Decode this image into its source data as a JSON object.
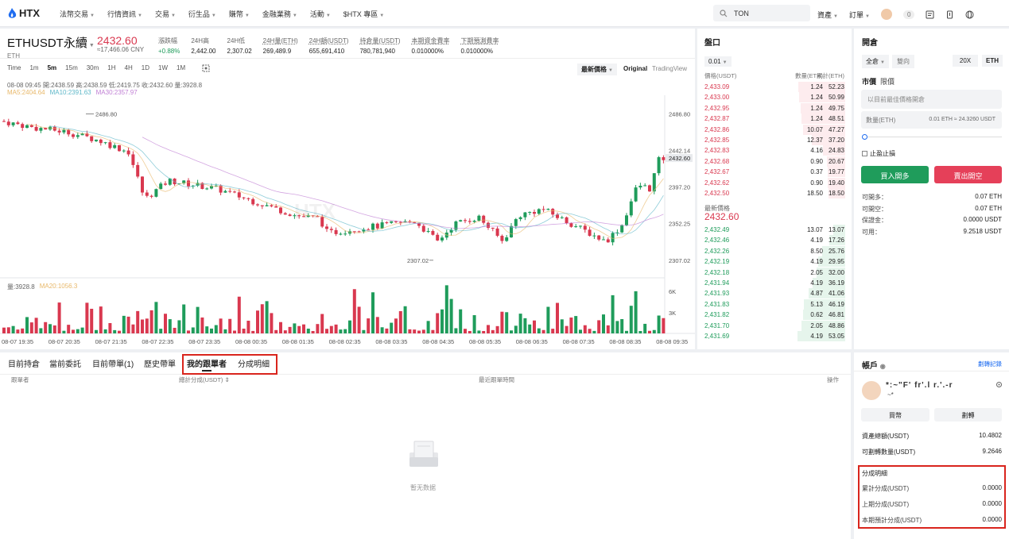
{
  "topbar": {
    "logo": "HTX",
    "nav": [
      "法幣交易",
      "行情資訊",
      "交易",
      "衍生品",
      "賺幣",
      "金融業務",
      "活動",
      "$HTX 專區"
    ],
    "search": "TON",
    "right": [
      "資產",
      "訂單"
    ],
    "badge": "0"
  },
  "ticker": {
    "symbol": "ETHUSDT永續",
    "base": "ETH",
    "price": "2432.60",
    "cny": "≈17,466.06 CNY",
    "stats": [
      {
        "l": "漲跌幅",
        "v": "+0.88%"
      },
      {
        "l": "24H高",
        "v": "2,442.00"
      },
      {
        "l": "24H低",
        "v": "2,307.02"
      },
      {
        "l": "24H量(ETH)",
        "v": "269,489.9"
      },
      {
        "l": "24H額(USDT)",
        "v": "655,691,410"
      },
      {
        "l": "持倉量(USDT)",
        "v": "780,781,940"
      },
      {
        "l": "本期資金費率",
        "v": "0.010000%"
      },
      {
        "l": "下期預測費率",
        "v": "0.010000%"
      }
    ]
  },
  "timeframes": [
    "Time",
    "1m",
    "5m",
    "15m",
    "30m",
    "1H",
    "4H",
    "1D",
    "1W",
    "1M"
  ],
  "chart_opts": {
    "latest": "最新價格",
    "original": "Original",
    "tv": "TradingView"
  },
  "ohlc_line": "08-08 09:45  開:2438.59 高:2438.59 低:2419.75 收:2432.60 量:3928.8",
  "ma_line": {
    "ma5": "MA5:2404.64",
    "ma10": "MA10:2391.63",
    "ma30": "MA30:2357.97"
  },
  "vol_line": {
    "vol": "量:3928.8",
    "ma": "MA20:1056.3"
  },
  "chart_data": {
    "type": "candlestick",
    "yticks": [
      "2486.80",
      "2442.14",
      "2432.60",
      "2397.20",
      "2352.25",
      "2307.02"
    ],
    "xticks": [
      "08-07 19:35",
      "08-07 20:35",
      "08-07 21:35",
      "08-07 22:35",
      "08-07 23:35",
      "08-08 00:35",
      "08-08 01:35",
      "08-08 02:35",
      "08-08 03:35",
      "08-08 04:35",
      "08-08 05:35",
      "08-08 06:35",
      "08-08 07:35",
      "08-08 08:35",
      "08-08 09:35"
    ],
    "high_label": "2486.80",
    "low_label": "2307.02",
    "vol_ticks": [
      "6K",
      "3K"
    ]
  },
  "book": {
    "title": "盤口",
    "step": "0.01",
    "headers": [
      "價格(USDT)",
      "數量(ETH)",
      "累計(ETH)"
    ],
    "asks": [
      [
        "2,433.09",
        "1.24",
        "52.23"
      ],
      [
        "2,433.00",
        "1.24",
        "50.99"
      ],
      [
        "2,432.95",
        "1.24",
        "49.75"
      ],
      [
        "2,432.87",
        "1.24",
        "48.51"
      ],
      [
        "2,432.86",
        "10.07",
        "47.27"
      ],
      [
        "2,432.85",
        "12.37",
        "37.20"
      ],
      [
        "2,432.83",
        "4.16",
        "24.83"
      ],
      [
        "2,432.68",
        "0.90",
        "20.67"
      ],
      [
        "2,432.67",
        "0.37",
        "19.77"
      ],
      [
        "2,432.62",
        "0.90",
        "19.40"
      ],
      [
        "2,432.50",
        "18.50",
        "18.50"
      ]
    ],
    "latest_label": "最新價格",
    "latest": "2432.60",
    "bids": [
      [
        "2,432.49",
        "13.07",
        "13.07"
      ],
      [
        "2,432.46",
        "4.19",
        "17.26"
      ],
      [
        "2,432.26",
        "8.50",
        "25.76"
      ],
      [
        "2,432.19",
        "4.19",
        "29.95"
      ],
      [
        "2,432.18",
        "2.05",
        "32.00"
      ],
      [
        "2,431.94",
        "4.19",
        "36.19"
      ],
      [
        "2,431.93",
        "4.87",
        "41.06"
      ],
      [
        "2,431.83",
        "5.13",
        "46.19"
      ],
      [
        "2,431.82",
        "0.62",
        "46.81"
      ],
      [
        "2,431.70",
        "2.05",
        "48.86"
      ],
      [
        "2,431.69",
        "4.19",
        "53.05"
      ]
    ]
  },
  "order": {
    "title": "開倉",
    "mode": "全倉",
    "mode2": "雙向",
    "lev": "20X",
    "coin": "ETH",
    "tab1": "市價",
    "tab2": "限價",
    "price_ph": "以目前最佳價格開倉",
    "qty_label": "數量(ETH)",
    "qty_hint": "0.01 ETH ≈ 24.3260 USDT",
    "tpsl": "止盈止損",
    "buy": "買入開多",
    "sell": "賣出開空",
    "info": [
      [
        "可開多：",
        "0.07 ETH"
      ],
      [
        "可開空：",
        "0.07 ETH"
      ],
      [
        "保證金：",
        "0.0000 USDT"
      ],
      [
        "可用：",
        "9.2518 USDT"
      ]
    ]
  },
  "tabs": [
    "目前持倉",
    "當前委託",
    "目前帶單(1)",
    "歷史帶單",
    "我的跟單者",
    "分成明細"
  ],
  "table_headers": {
    "c1": "跟單者",
    "c2": "總計分成(USDT)",
    "c3": "最近跟單時間",
    "c4": "操作"
  },
  "empty": "暫无数据",
  "account": {
    "title": "帳戶",
    "record": "劃轉記錄",
    "name": "*:~\"F' fr'.l r.'.-r",
    "sub": "~*",
    "btn1": "買幣",
    "btn2": "劃轉",
    "rows": [
      [
        "資產總額(USDT)",
        "10.4802"
      ],
      [
        "可劃轉數量(USDT)",
        "9.2646"
      ]
    ],
    "share_title": "分成明細",
    "share": [
      [
        "累計分成(USDT)",
        "0.0000"
      ],
      [
        "上期分成(USDT)",
        "0.0000"
      ],
      [
        "本期預計分成(USDT)",
        "0.0000"
      ]
    ]
  }
}
